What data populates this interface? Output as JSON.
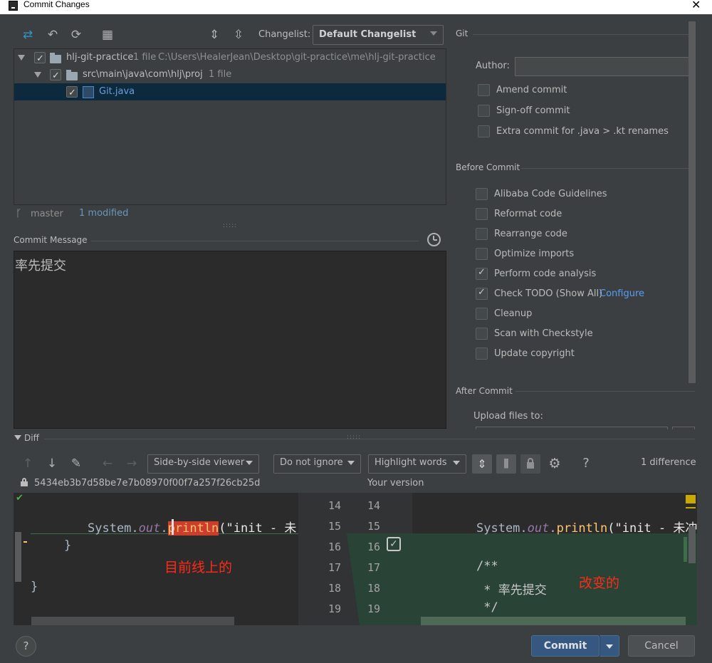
{
  "dialog": {
    "title": "Commit Changes",
    "close": "✕"
  },
  "toolbar": {
    "changelist_label": "Changelist:",
    "changelist_value": "Default Changelist"
  },
  "tree": {
    "root": {
      "label": "hlj-git-practice",
      "count": "1 file",
      "path": "C:\\Users\\HealerJean\\Desktop\\git-practice\\me\\hlj-git-practice"
    },
    "folder": {
      "label": "src\\main\\java\\com\\hlj\\proj",
      "count": "1 file"
    },
    "file": {
      "label": "Git.java"
    }
  },
  "status": {
    "branch": "master",
    "modified": "1 modified"
  },
  "commit_message": {
    "label": "Commit Message",
    "text": "率先提交"
  },
  "git": {
    "title": "Git",
    "author_label": "Author:",
    "author_value": "",
    "options": [
      "Amend commit",
      "Sign-off commit",
      "Extra commit for .java > .kt renames"
    ]
  },
  "before_commit": {
    "title": "Before Commit",
    "options": [
      {
        "label": "Alibaba Code Guidelines",
        "checked": false
      },
      {
        "label": "Reformat code",
        "checked": false
      },
      {
        "label": "Rearrange code",
        "checked": false
      },
      {
        "label": "Optimize imports",
        "checked": false
      },
      {
        "label": "Perform code analysis",
        "checked": true
      },
      {
        "label": "Check TODO (Show All)",
        "checked": true,
        "link": "Configure"
      },
      {
        "label": "Cleanup",
        "checked": false
      },
      {
        "label": "Scan with Checkstyle",
        "checked": false
      },
      {
        "label": "Update copyright",
        "checked": false
      }
    ]
  },
  "after_commit": {
    "title": "After Commit",
    "upload_label": "Upload files to:"
  },
  "diff": {
    "title": "Diff",
    "viewer": "Side-by-side viewer",
    "ignore": "Do not ignore",
    "highlight": "Highlight words",
    "differences": "1 difference",
    "left_hash": "5434eb3b7d58be7e7b08970f00f7a257f26cb25d",
    "right_title": "Your version",
    "left_lines": [
      "14",
      "15",
      "16",
      "17",
      "18",
      "19"
    ],
    "right_lines": [
      "14",
      "15",
      "16",
      "17",
      "18",
      "19"
    ],
    "left_code": {
      "line15_a": "System.",
      "line15_b": "out",
      "line15_c": ".",
      "line15_d": "println",
      "line15_e": "(\"init - 未",
      "line16": "    }",
      "line18": "}"
    },
    "right_code": {
      "line15_a": "System.",
      "line15_b": "out",
      "line15_c": ".",
      "line15_d": "println",
      "line15_e": "(\"init - 未冲",
      "line17": "/**",
      "line18": " * 率先提交",
      "line19": " */"
    },
    "annotation_left": "目前线上的",
    "annotation_right": "改变的"
  },
  "buttons": {
    "commit": "Commit",
    "cancel": "Cancel",
    "help": "?"
  },
  "colors": {
    "annotation": "#ff2a1a",
    "selected_row": "#0d293e",
    "insert_bg": "#294436",
    "primary_button": "#365880"
  }
}
